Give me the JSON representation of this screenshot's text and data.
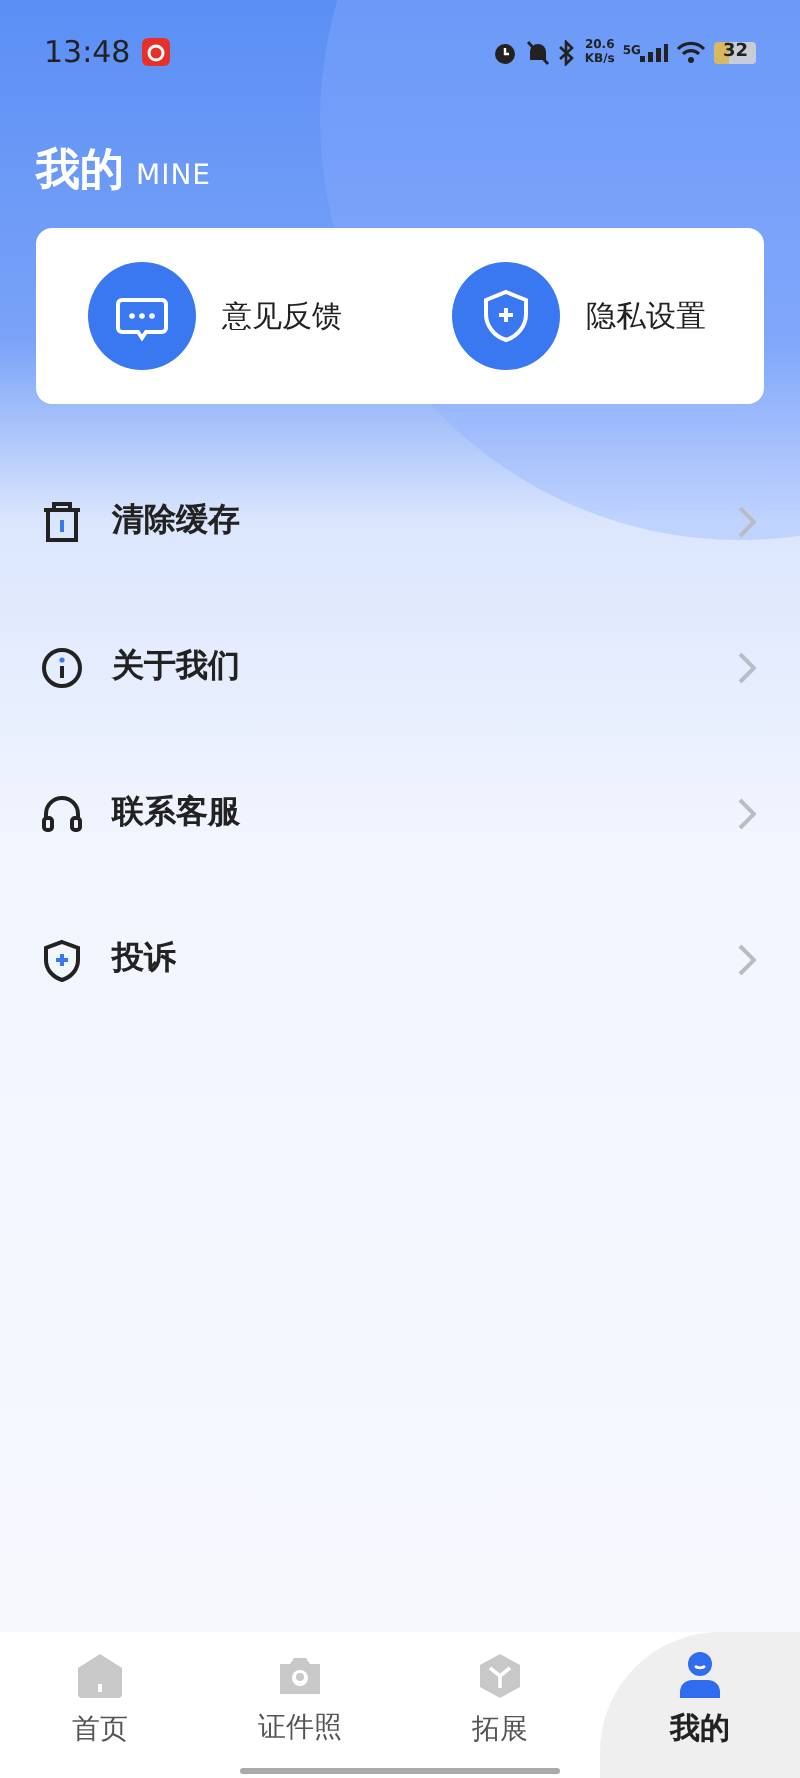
{
  "status_bar": {
    "time": "13:48",
    "speed": "20.6",
    "speed_unit": "KB/s",
    "network": "5G",
    "battery": "32"
  },
  "header": {
    "title": "我的",
    "subtitle": "MINE"
  },
  "quick_actions": [
    {
      "kind": "feedback",
      "label": "意见反馈"
    },
    {
      "kind": "privacy",
      "label": "隐私设置"
    }
  ],
  "menu": [
    {
      "kind": "trash",
      "label": "清除缓存"
    },
    {
      "kind": "info",
      "label": "关于我们"
    },
    {
      "kind": "headset",
      "label": "联系客服"
    },
    {
      "kind": "shield",
      "label": "投诉"
    }
  ],
  "tabs": [
    {
      "kind": "home",
      "label": "首页",
      "selected": false
    },
    {
      "kind": "camera",
      "label": "证件照",
      "selected": false
    },
    {
      "kind": "box",
      "label": "拓展",
      "selected": false
    },
    {
      "kind": "person",
      "label": "我的",
      "selected": true
    }
  ]
}
